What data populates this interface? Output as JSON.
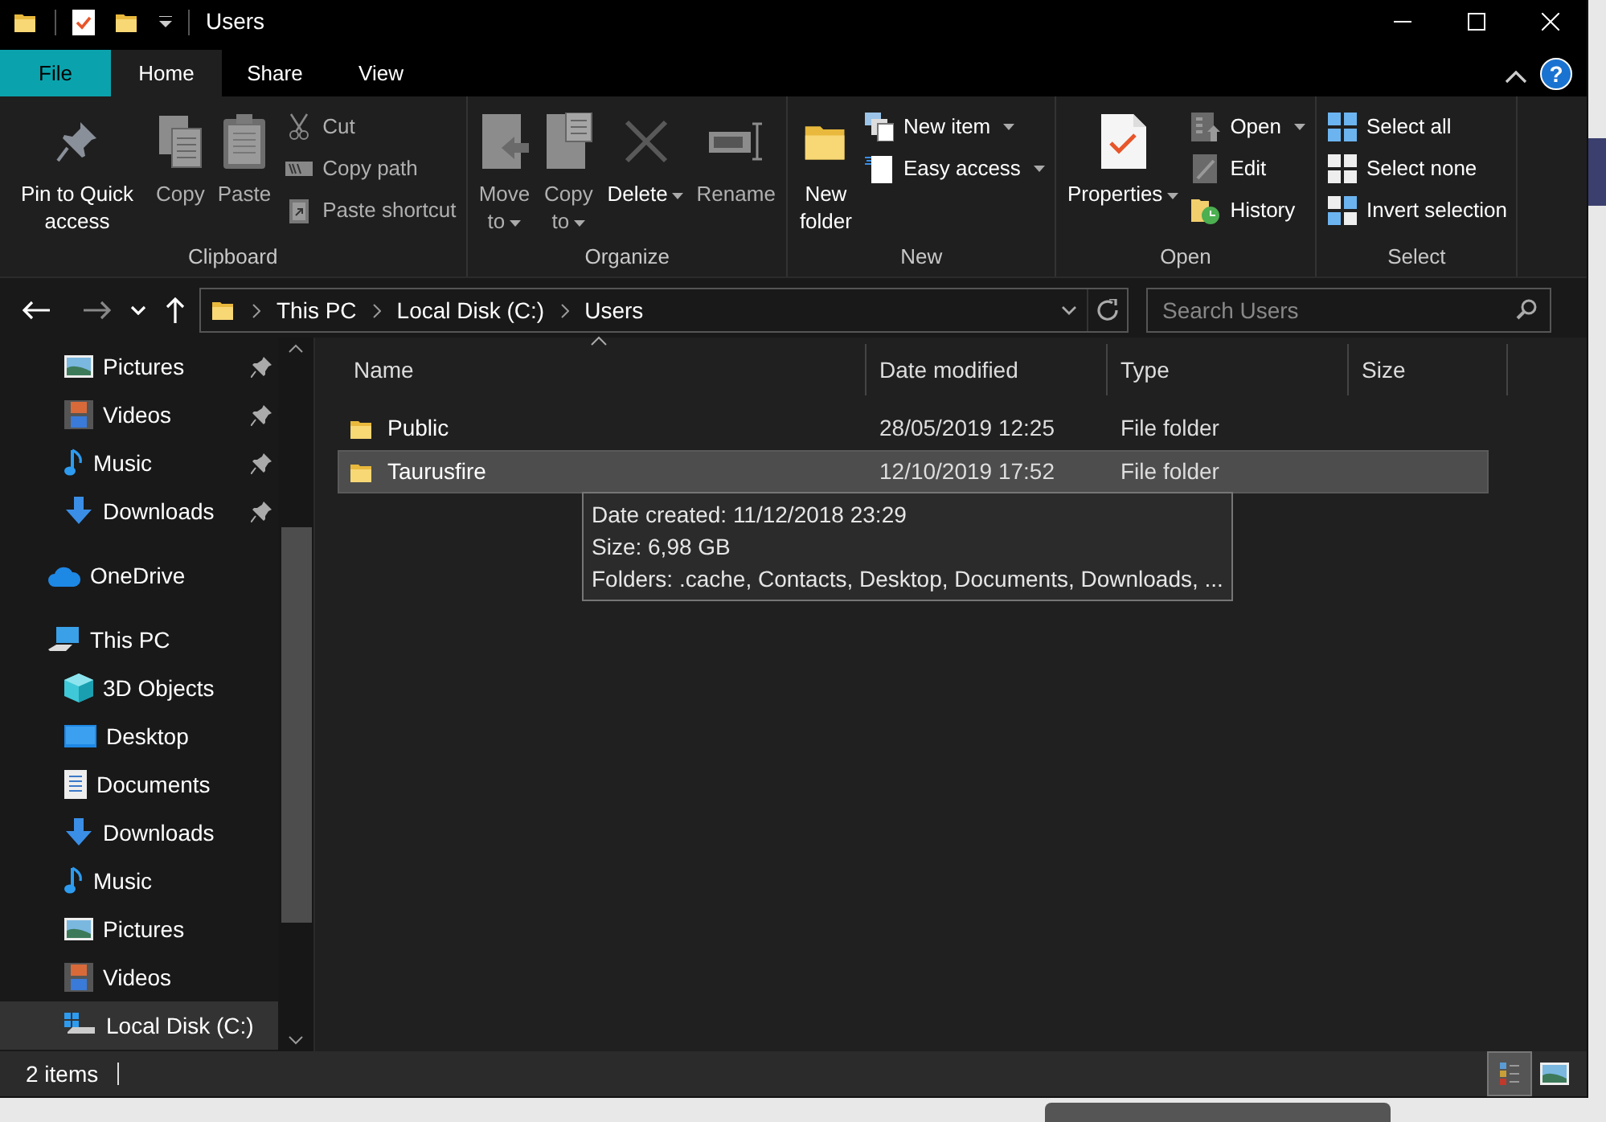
{
  "window": {
    "title": "Users"
  },
  "tabs": [
    {
      "label": "File",
      "kind": "file",
      "selected": false
    },
    {
      "label": "Home",
      "kind": "tab",
      "selected": true
    },
    {
      "label": "Share",
      "kind": "tab",
      "selected": false
    },
    {
      "label": "View",
      "kind": "tab",
      "selected": false
    }
  ],
  "help_button": {
    "label": "?"
  },
  "ribbon": {
    "groups": [
      {
        "label": "Clipboard",
        "items": [
          {
            "kind": "large",
            "label": "Pin to Quick access",
            "disabled": false,
            "dropdown": false
          },
          {
            "kind": "large",
            "label": "Copy",
            "disabled": true,
            "dropdown": false
          },
          {
            "kind": "large",
            "label": "Paste",
            "disabled": true,
            "dropdown": false
          },
          {
            "kind": "small",
            "label": "Cut",
            "disabled": true,
            "dropdown": false
          },
          {
            "kind": "small",
            "label": "Copy path",
            "disabled": true,
            "dropdown": false
          },
          {
            "kind": "small",
            "label": "Paste shortcut",
            "disabled": true,
            "dropdown": false
          }
        ]
      },
      {
        "label": "Organize",
        "items": [
          {
            "kind": "large",
            "label": "Move to",
            "disabled": true,
            "dropdown": true
          },
          {
            "kind": "large",
            "label": "Copy to",
            "disabled": true,
            "dropdown": true
          },
          {
            "kind": "large",
            "label": "Delete",
            "disabled": false,
            "dropdown": true
          },
          {
            "kind": "large",
            "label": "Rename",
            "disabled": true,
            "dropdown": false
          }
        ]
      },
      {
        "label": "New",
        "items": [
          {
            "kind": "large",
            "label": "New folder",
            "disabled": false,
            "dropdown": false
          },
          {
            "kind": "small",
            "label": "New item",
            "disabled": false,
            "dropdown": true
          },
          {
            "kind": "small",
            "label": "Easy access",
            "disabled": false,
            "dropdown": true
          }
        ]
      },
      {
        "label": "Open",
        "items": [
          {
            "kind": "large",
            "label": "Properties",
            "disabled": false,
            "dropdown": true
          },
          {
            "kind": "small",
            "label": "Open",
            "disabled": false,
            "dropdown": true
          },
          {
            "kind": "small",
            "label": "Edit",
            "disabled": false,
            "dropdown": false
          },
          {
            "kind": "small",
            "label": "History",
            "disabled": false,
            "dropdown": false
          }
        ]
      },
      {
        "label": "Select",
        "items": [
          {
            "kind": "small",
            "label": "Select all",
            "disabled": false,
            "dropdown": false
          },
          {
            "kind": "small",
            "label": "Select none",
            "disabled": false,
            "dropdown": false
          },
          {
            "kind": "small",
            "label": "Invert selection",
            "disabled": false,
            "dropdown": false
          }
        ]
      }
    ]
  },
  "address_bar": {
    "path": [
      "This PC",
      "Local Disk (C:)",
      "Users"
    ]
  },
  "search": {
    "placeholder": "Search Users"
  },
  "sidebar": {
    "quick_access": [
      {
        "label": "Pictures",
        "pinned": true,
        "selected": false
      },
      {
        "label": "Videos",
        "pinned": true,
        "selected": false
      },
      {
        "label": "Music",
        "pinned": true,
        "selected": false
      },
      {
        "label": "Downloads",
        "pinned": true,
        "selected": false
      }
    ],
    "items": [
      {
        "label": "OneDrive",
        "selected": false
      },
      {
        "label": "This PC",
        "selected": false,
        "children": [
          {
            "label": "3D Objects",
            "selected": false
          },
          {
            "label": "Desktop",
            "selected": false
          },
          {
            "label": "Documents",
            "selected": false
          },
          {
            "label": "Downloads",
            "selected": false
          },
          {
            "label": "Music",
            "selected": false
          },
          {
            "label": "Pictures",
            "selected": false
          },
          {
            "label": "Videos",
            "selected": false
          },
          {
            "label": "Local Disk (C:)",
            "selected": true
          }
        ]
      }
    ]
  },
  "file_list": {
    "columns": [
      "Name",
      "Date modified",
      "Type",
      "Size"
    ],
    "rows": [
      {
        "name": "Public",
        "date_modified": "28/05/2019 12:25",
        "type": "File folder",
        "selected": false
      },
      {
        "name": "Taurusfire",
        "date_modified": "12/10/2019 17:52",
        "type": "File folder",
        "selected": true
      }
    ]
  },
  "tooltip": {
    "lines": [
      "Date created: 11/12/2018 23:29",
      "Size: 6,98 GB",
      "Folders: .cache, Contacts, Desktop, Documents, Downloads, ..."
    ]
  },
  "status_bar": {
    "item_count": "2 items",
    "views": [
      {
        "kind": "details",
        "selected": true
      },
      {
        "kind": "large_icons",
        "selected": false
      }
    ]
  }
}
